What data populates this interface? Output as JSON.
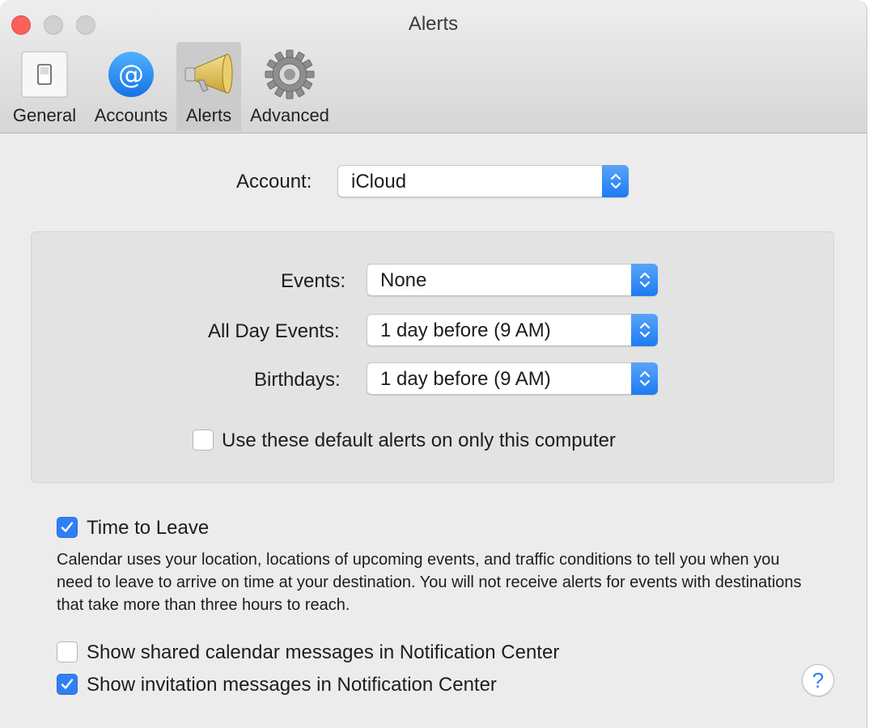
{
  "window": {
    "title": "Alerts"
  },
  "toolbar": {
    "tabs": [
      {
        "label": "General",
        "icon": "switch-icon"
      },
      {
        "label": "Accounts",
        "icon": "at-sign-icon"
      },
      {
        "label": "Alerts",
        "icon": "megaphone-icon",
        "selected": true
      },
      {
        "label": "Advanced",
        "icon": "gear-icon"
      }
    ]
  },
  "account": {
    "label": "Account:",
    "value": "iCloud"
  },
  "defaults": {
    "events": {
      "label": "Events:",
      "value": "None"
    },
    "all_day": {
      "label": "All Day Events:",
      "value": "1 day before (9 AM)"
    },
    "birthdays": {
      "label": "Birthdays:",
      "value": "1 day before (9 AM)"
    },
    "local_only": {
      "label": "Use these default alerts on only this computer",
      "checked": false
    }
  },
  "time_to_leave": {
    "label": "Time to Leave",
    "checked": true,
    "description": "Calendar uses your location, locations of upcoming events, and traffic conditions to tell you when you need to leave to arrive on time at your destination. You will not receive alerts for events with destinations that take more than three hours to reach."
  },
  "notifications": {
    "shared": {
      "label": "Show shared calendar messages in Notification Center",
      "checked": false
    },
    "invitations": {
      "label": "Show invitation messages in Notification Center",
      "checked": true
    }
  },
  "help": {
    "glyph": "?"
  },
  "colors": {
    "accent": "#2f7ff5",
    "close": "#fc605c"
  }
}
